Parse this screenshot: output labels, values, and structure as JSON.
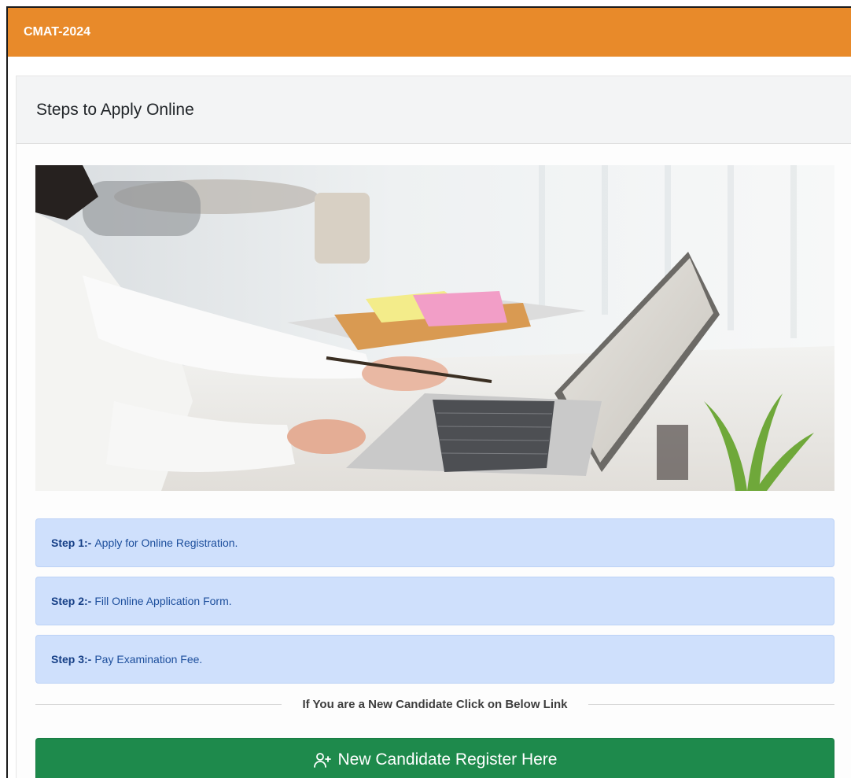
{
  "header": {
    "title": "CMAT-2024",
    "accent_color": "#e88a2a"
  },
  "card": {
    "title": "Steps to Apply Online"
  },
  "hero_image": {
    "description_icon": "office-laptop-photo"
  },
  "steps": [
    {
      "label": "Step 1:-",
      "text": "Apply for Online Registration."
    },
    {
      "label": "Step 2:-",
      "text": "Fill Online Application Form."
    },
    {
      "label": "Step 3:-",
      "text": "Pay Examination Fee."
    }
  ],
  "divider": {
    "text": "If You are a New Candidate Click on Below Link"
  },
  "register": {
    "label": "New Candidate Register Here",
    "icon": "user-plus-icon",
    "color": "#1e8a4c"
  },
  "colors": {
    "step_bg": "#cfe0fc",
    "step_text": "#1c4e9c"
  }
}
